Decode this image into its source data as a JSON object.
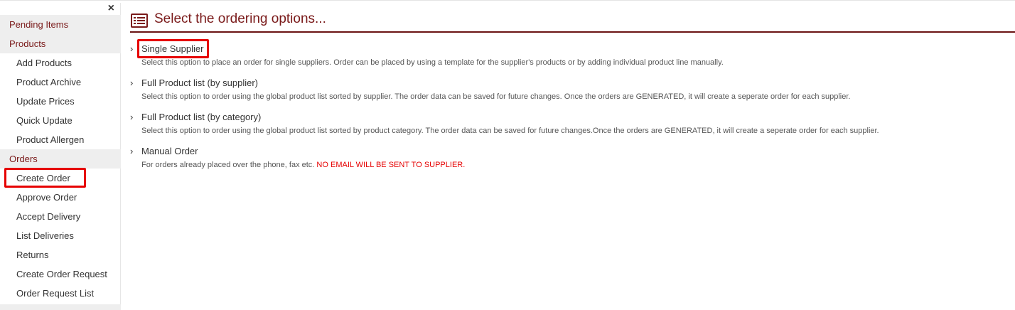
{
  "sidebar": {
    "close_label": "×",
    "sections": [
      {
        "label": "Pending Items"
      },
      {
        "label": "Products"
      },
      {
        "label": "Orders"
      }
    ],
    "product_items": [
      {
        "label": "Add Products"
      },
      {
        "label": "Product Archive"
      },
      {
        "label": "Update Prices"
      },
      {
        "label": "Quick Update"
      },
      {
        "label": "Product Allergen"
      }
    ],
    "order_items": [
      {
        "label": "Create Order"
      },
      {
        "label": "Approve Order"
      },
      {
        "label": "Accept Delivery"
      },
      {
        "label": "List Deliveries"
      },
      {
        "label": "Returns"
      },
      {
        "label": "Create Order Request"
      },
      {
        "label": "Order Request List"
      }
    ],
    "selected_item": "Create Order"
  },
  "main": {
    "title": "Select the ordering options...",
    "icon": "list-icon",
    "options": [
      {
        "title": "Single Supplier",
        "description": "Select this option to place an order for single suppliers. Order can be placed by using a template for the supplier's products or by adding individual product line manually."
      },
      {
        "title": "Full Product list (by supplier)",
        "description": "Select this option to order using the global product list sorted by supplier. The order data can be saved for future changes. Once the orders are GENERATED, it will create a seperate order for each supplier."
      },
      {
        "title": "Full Product list (by category)",
        "description": "Select this option to order using the global product list sorted by product category. The order data can be saved for future changes.Once the orders are GENERATED, it will create a seperate order for each supplier."
      },
      {
        "title": "Manual Order",
        "description": "For orders already placed over the phone, fax etc.",
        "warning": "NO EMAIL WILL BE SENT TO SUPPLIER."
      }
    ]
  },
  "colors": {
    "accent": "#7a1a1a",
    "highlight": "#e60000",
    "section_bg": "#eeeeee"
  }
}
